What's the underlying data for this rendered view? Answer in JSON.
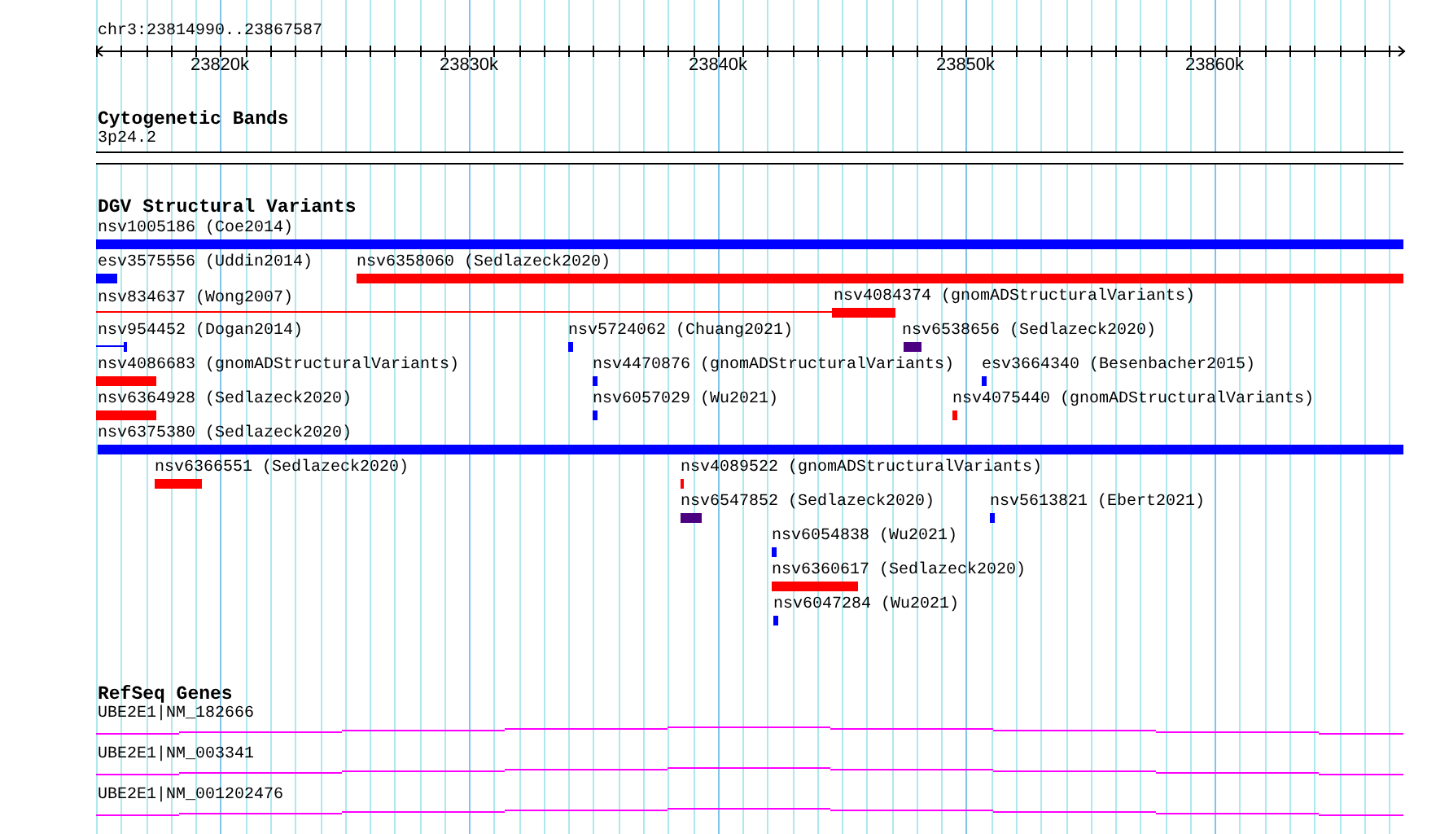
{
  "ruler": {
    "location": "chr3:23814990..23867587",
    "ticks": [
      "23820k",
      "23830k",
      "23840k",
      "23850k",
      "23860k"
    ]
  },
  "tracks": [
    {
      "title": "Cytogenetic Bands",
      "kind": "bands",
      "features": [
        {
          "label": "3p24.2"
        }
      ]
    },
    {
      "title": "DGV Structural Variants",
      "kind": "variants",
      "features": [
        {
          "label": "nsv1005186 (Coe2014)",
          "color": "#0000ff",
          "kind": "bar"
        },
        {
          "label": "esv3575556 (Uddin2014)",
          "color": "#0000ff",
          "kind": "bar"
        },
        {
          "label": "nsv6358060 (Sedlazeck2020)",
          "color": "#ff0000",
          "kind": "bar"
        },
        {
          "label": "nsv834637 (Wong2007)",
          "color": "#ff0000",
          "kind": "line"
        },
        {
          "label": "nsv4084374 (gnomADStructuralVariants)",
          "color": "#ff0000",
          "kind": "bar"
        },
        {
          "label": "nsv954452 (Dogan2014)",
          "color": "#0000ff",
          "kind": "line"
        },
        {
          "label": "nsv5724062 (Chuang2021)",
          "color": "#0000ff",
          "kind": "bar"
        },
        {
          "label": "nsv6538656 (Sedlazeck2020)",
          "color": "#4b0082",
          "kind": "bar"
        },
        {
          "label": "nsv4086683 (gnomADStructuralVariants)",
          "color": "#ff0000",
          "kind": "bar"
        },
        {
          "label": "nsv4470876 (gnomADStructuralVariants)",
          "color": "#0000ff",
          "kind": "bar"
        },
        {
          "label": "esv3664340 (Besenbacher2015)",
          "color": "#0000ff",
          "kind": "bar"
        },
        {
          "label": "nsv6364928 (Sedlazeck2020)",
          "color": "#ff0000",
          "kind": "bar"
        },
        {
          "label": "nsv6057029 (Wu2021)",
          "color": "#0000ff",
          "kind": "bar"
        },
        {
          "label": "nsv4075440 (gnomADStructuralVariants)",
          "color": "#ff0000",
          "kind": "bar"
        },
        {
          "label": "nsv6375380 (Sedlazeck2020)",
          "color": "#0000ff",
          "kind": "bar"
        },
        {
          "label": "nsv6366551 (Sedlazeck2020)",
          "color": "#ff0000",
          "kind": "bar"
        },
        {
          "label": "nsv4089522 (gnomADStructuralVariants)",
          "color": "#ff0000",
          "kind": "bar"
        },
        {
          "label": "nsv6547852 (Sedlazeck2020)",
          "color": "#4b0082",
          "kind": "bar"
        },
        {
          "label": "nsv5613821 (Ebert2021)",
          "color": "#0000ff",
          "kind": "bar"
        },
        {
          "label": "nsv6054838 (Wu2021)",
          "color": "#0000ff",
          "kind": "bar"
        },
        {
          "label": "nsv6360617 (Sedlazeck2020)",
          "color": "#ff0000",
          "kind": "bar"
        },
        {
          "label": "nsv6047284 (Wu2021)",
          "color": "#0000ff",
          "kind": "bar"
        }
      ]
    },
    {
      "title": "RefSeq Genes",
      "kind": "genes",
      "features": [
        {
          "label": "UBE2E1|NM_182666"
        },
        {
          "label": "UBE2E1|NM_003341"
        },
        {
          "label": "UBE2E1|NM_001202476"
        }
      ]
    }
  ]
}
